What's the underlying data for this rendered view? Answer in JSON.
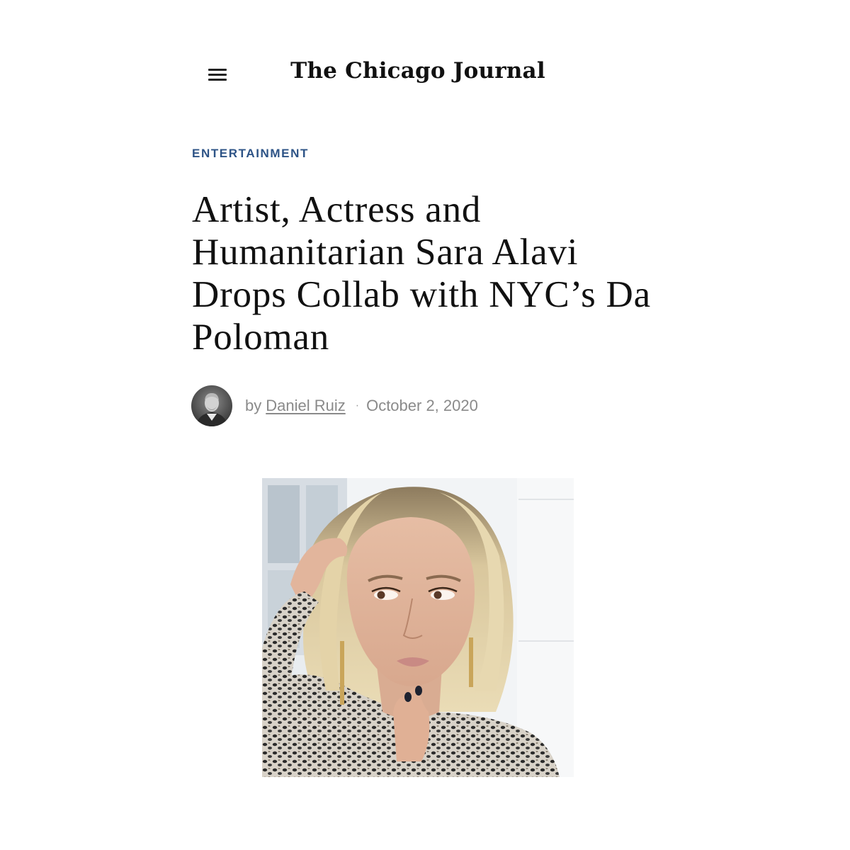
{
  "header": {
    "menu_icon": "hamburger-menu-icon",
    "site_title": "The Chicago Journal"
  },
  "article": {
    "category": "ENTERTAINMENT",
    "headline": "Artist, Actress and Humanitarian Sara Alavi Drops Collab with NYC’s Da Poloman",
    "byline": {
      "by_label": "by",
      "author": "Daniel Ruiz",
      "separator": "·",
      "date": "October 2, 2020"
    }
  },
  "colors": {
    "category": "#2d5386",
    "byline_text": "#8a8a8a",
    "headline_text": "#111111"
  }
}
